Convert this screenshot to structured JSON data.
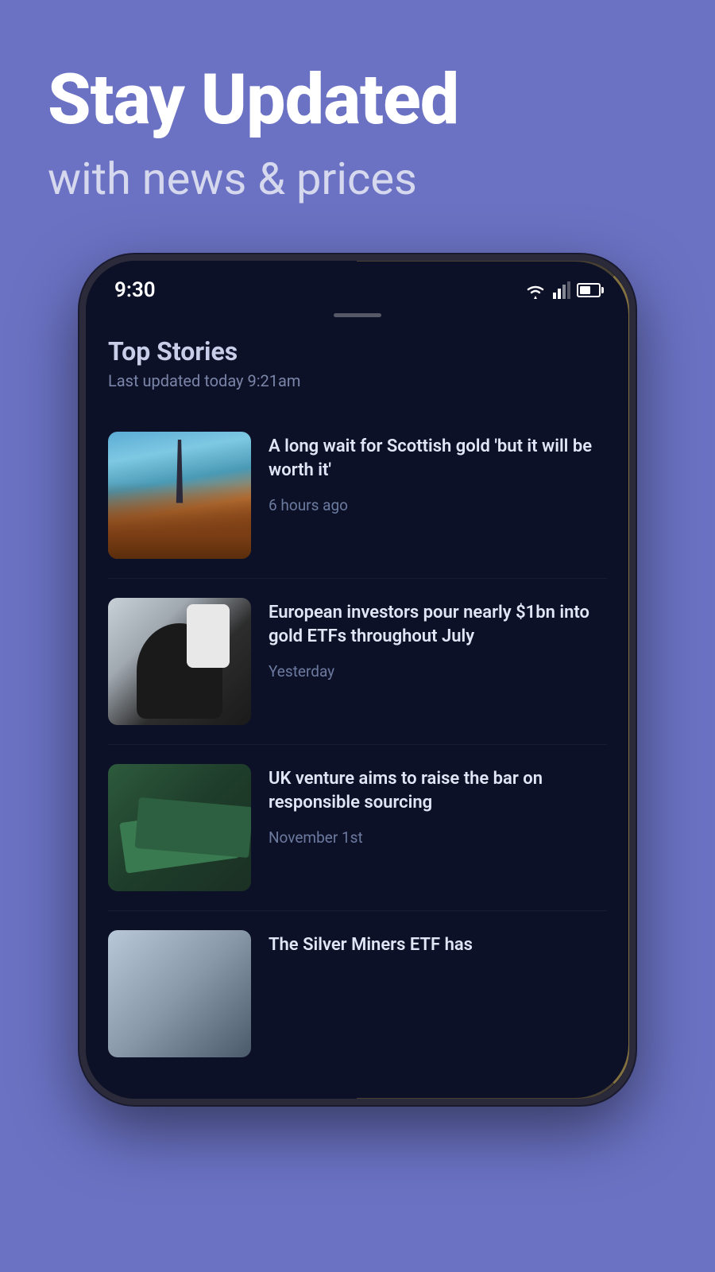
{
  "hero": {
    "title": "Stay Updated",
    "subtitle": "with news & prices"
  },
  "status_bar": {
    "time": "9:30"
  },
  "screen": {
    "section_title": "Top Stories",
    "last_updated": "Last updated today 9:21am",
    "news_items": [
      {
        "id": 1,
        "headline": "A long wait for Scottish gold 'but it will be worth it'",
        "time": "6 hours ago",
        "image_alt": "Scottish monument with statue"
      },
      {
        "id": 2,
        "headline": "European investors pour nearly $1bn into gold ETFs throughout July",
        "time": "Yesterday",
        "image_alt": "Man with phone and coffee"
      },
      {
        "id": 3,
        "headline": "UK venture aims to raise the bar on responsible sourcing",
        "time": "November 1st",
        "image_alt": "Green packaged products"
      },
      {
        "id": 4,
        "headline": "The Silver Miners ETF has",
        "time": "",
        "image_alt": "Silver miners"
      }
    ]
  }
}
